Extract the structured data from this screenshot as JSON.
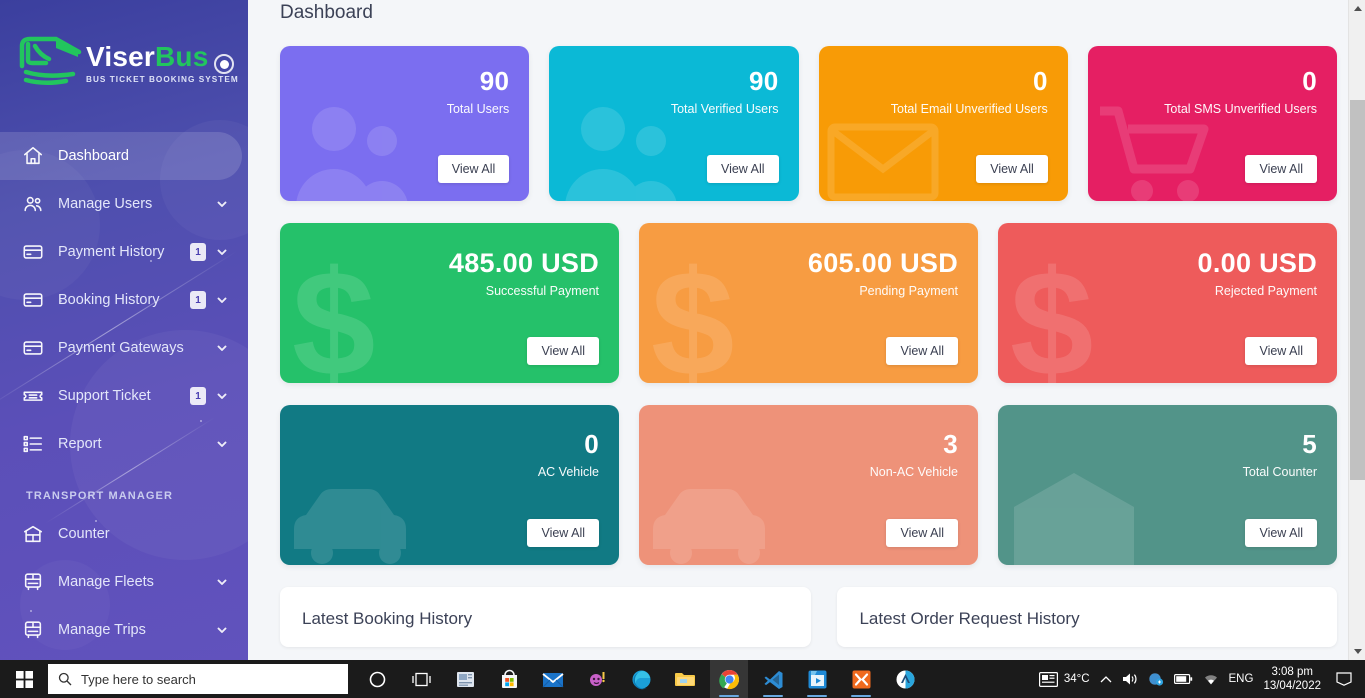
{
  "brand": {
    "name_first": "Viser",
    "name_second": "Bus",
    "tagline": "BUS TICKET BOOKING SYSTEM",
    "logo_icon": "bus-icon",
    "toggle_icon": "sidebar-toggle-icon"
  },
  "sidebar": {
    "items": [
      {
        "label": "Dashboard",
        "icon": "home-icon",
        "badge": null,
        "caret": false,
        "active": true
      },
      {
        "label": "Manage Users",
        "icon": "users-icon",
        "badge": null,
        "caret": true,
        "active": false
      },
      {
        "label": "Payment History",
        "icon": "card-icon",
        "badge": "1",
        "caret": true,
        "active": false
      },
      {
        "label": "Booking History",
        "icon": "card-icon",
        "badge": "1",
        "caret": true,
        "active": false
      },
      {
        "label": "Payment Gateways",
        "icon": "card-icon",
        "badge": null,
        "caret": true,
        "active": false
      },
      {
        "label": "Support Ticket",
        "icon": "ticket-icon",
        "badge": "1",
        "caret": true,
        "active": false
      },
      {
        "label": "Report",
        "icon": "list-icon",
        "badge": null,
        "caret": true,
        "active": false
      }
    ],
    "section_label": "TRANSPORT MANAGER",
    "section_items": [
      {
        "label": "Counter",
        "icon": "counter-icon",
        "badge": null,
        "caret": false,
        "active": false
      },
      {
        "label": "Manage Fleets",
        "icon": "fleet-icon",
        "badge": null,
        "caret": true,
        "active": false
      },
      {
        "label": "Manage Trips",
        "icon": "fleet-icon",
        "badge": null,
        "caret": true,
        "active": false
      }
    ]
  },
  "page": {
    "title": "Dashboard"
  },
  "cards": {
    "view_all": "View All",
    "row1": [
      {
        "value": "90",
        "label": "Total Users",
        "color": "#7b6ef0",
        "watermark": "users-icon"
      },
      {
        "value": "90",
        "label": "Total Verified Users",
        "color": "#0bb9d6",
        "watermark": "users-icon"
      },
      {
        "value": "0",
        "label": "Total Email Unverified Users",
        "color": "#f89b06",
        "watermark": "envelope-icon"
      },
      {
        "value": "0",
        "label": "Total SMS Unverified Users",
        "color": "#e51f63",
        "watermark": "cart-icon"
      }
    ],
    "row2": [
      {
        "value": "485.00 USD",
        "label": "Successful Payment",
        "color": "#25c16a",
        "watermark": "dollar-icon"
      },
      {
        "value": "605.00 USD",
        "label": "Pending Payment",
        "color": "#f79c42",
        "watermark": "dollar-icon"
      },
      {
        "value": "0.00 USD",
        "label": "Rejected Payment",
        "color": "#ee5b5b",
        "watermark": "dollar-icon"
      }
    ],
    "row3": [
      {
        "value": "0",
        "label": "AC Vehicle",
        "color": "#117a84",
        "watermark": "car-icon"
      },
      {
        "value": "3",
        "label": "Non-AC Vehicle",
        "color": "#ee9279",
        "watermark": "car-icon"
      },
      {
        "value": "5",
        "label": "Total Counter",
        "color": "#529489",
        "watermark": "counter-icon"
      }
    ]
  },
  "panels": [
    {
      "title": "Latest Booking History"
    },
    {
      "title": "Latest Order Request History"
    }
  ],
  "scrollbar": {
    "up_icon": "scroll-up-icon",
    "down_icon": "scroll-down-icon",
    "thumb": "scroll-thumb"
  },
  "taskbar": {
    "start_icon": "windows-start-icon",
    "search_icon": "search-icon",
    "search_placeholder": "Type here to search",
    "apps": [
      {
        "name": "cortana-icon"
      },
      {
        "name": "task-view-icon"
      },
      {
        "name": "news-icon"
      },
      {
        "name": "microsoft-store-icon"
      },
      {
        "name": "mail-icon"
      },
      {
        "name": "app-icon"
      },
      {
        "name": "microsoft-edge-icon"
      },
      {
        "name": "file-explorer-icon"
      },
      {
        "name": "google-chrome-icon"
      },
      {
        "name": "visual-studio-code-icon"
      },
      {
        "name": "media-player-icon"
      },
      {
        "name": "xampp-icon"
      },
      {
        "name": "app2-icon"
      }
    ],
    "tray": {
      "weather_icon": "news-weather-icon",
      "weather": "34°C",
      "chevron_icon": "chevron-up-icon",
      "volume_icon": "volume-icon",
      "network_icon": "network-icon",
      "battery_icon": "battery-icon",
      "wifi_icon": "wifi-icon",
      "language": "ENG",
      "time": "3:08 pm",
      "date": "13/04/2022",
      "notification_icon": "notification-icon"
    }
  }
}
